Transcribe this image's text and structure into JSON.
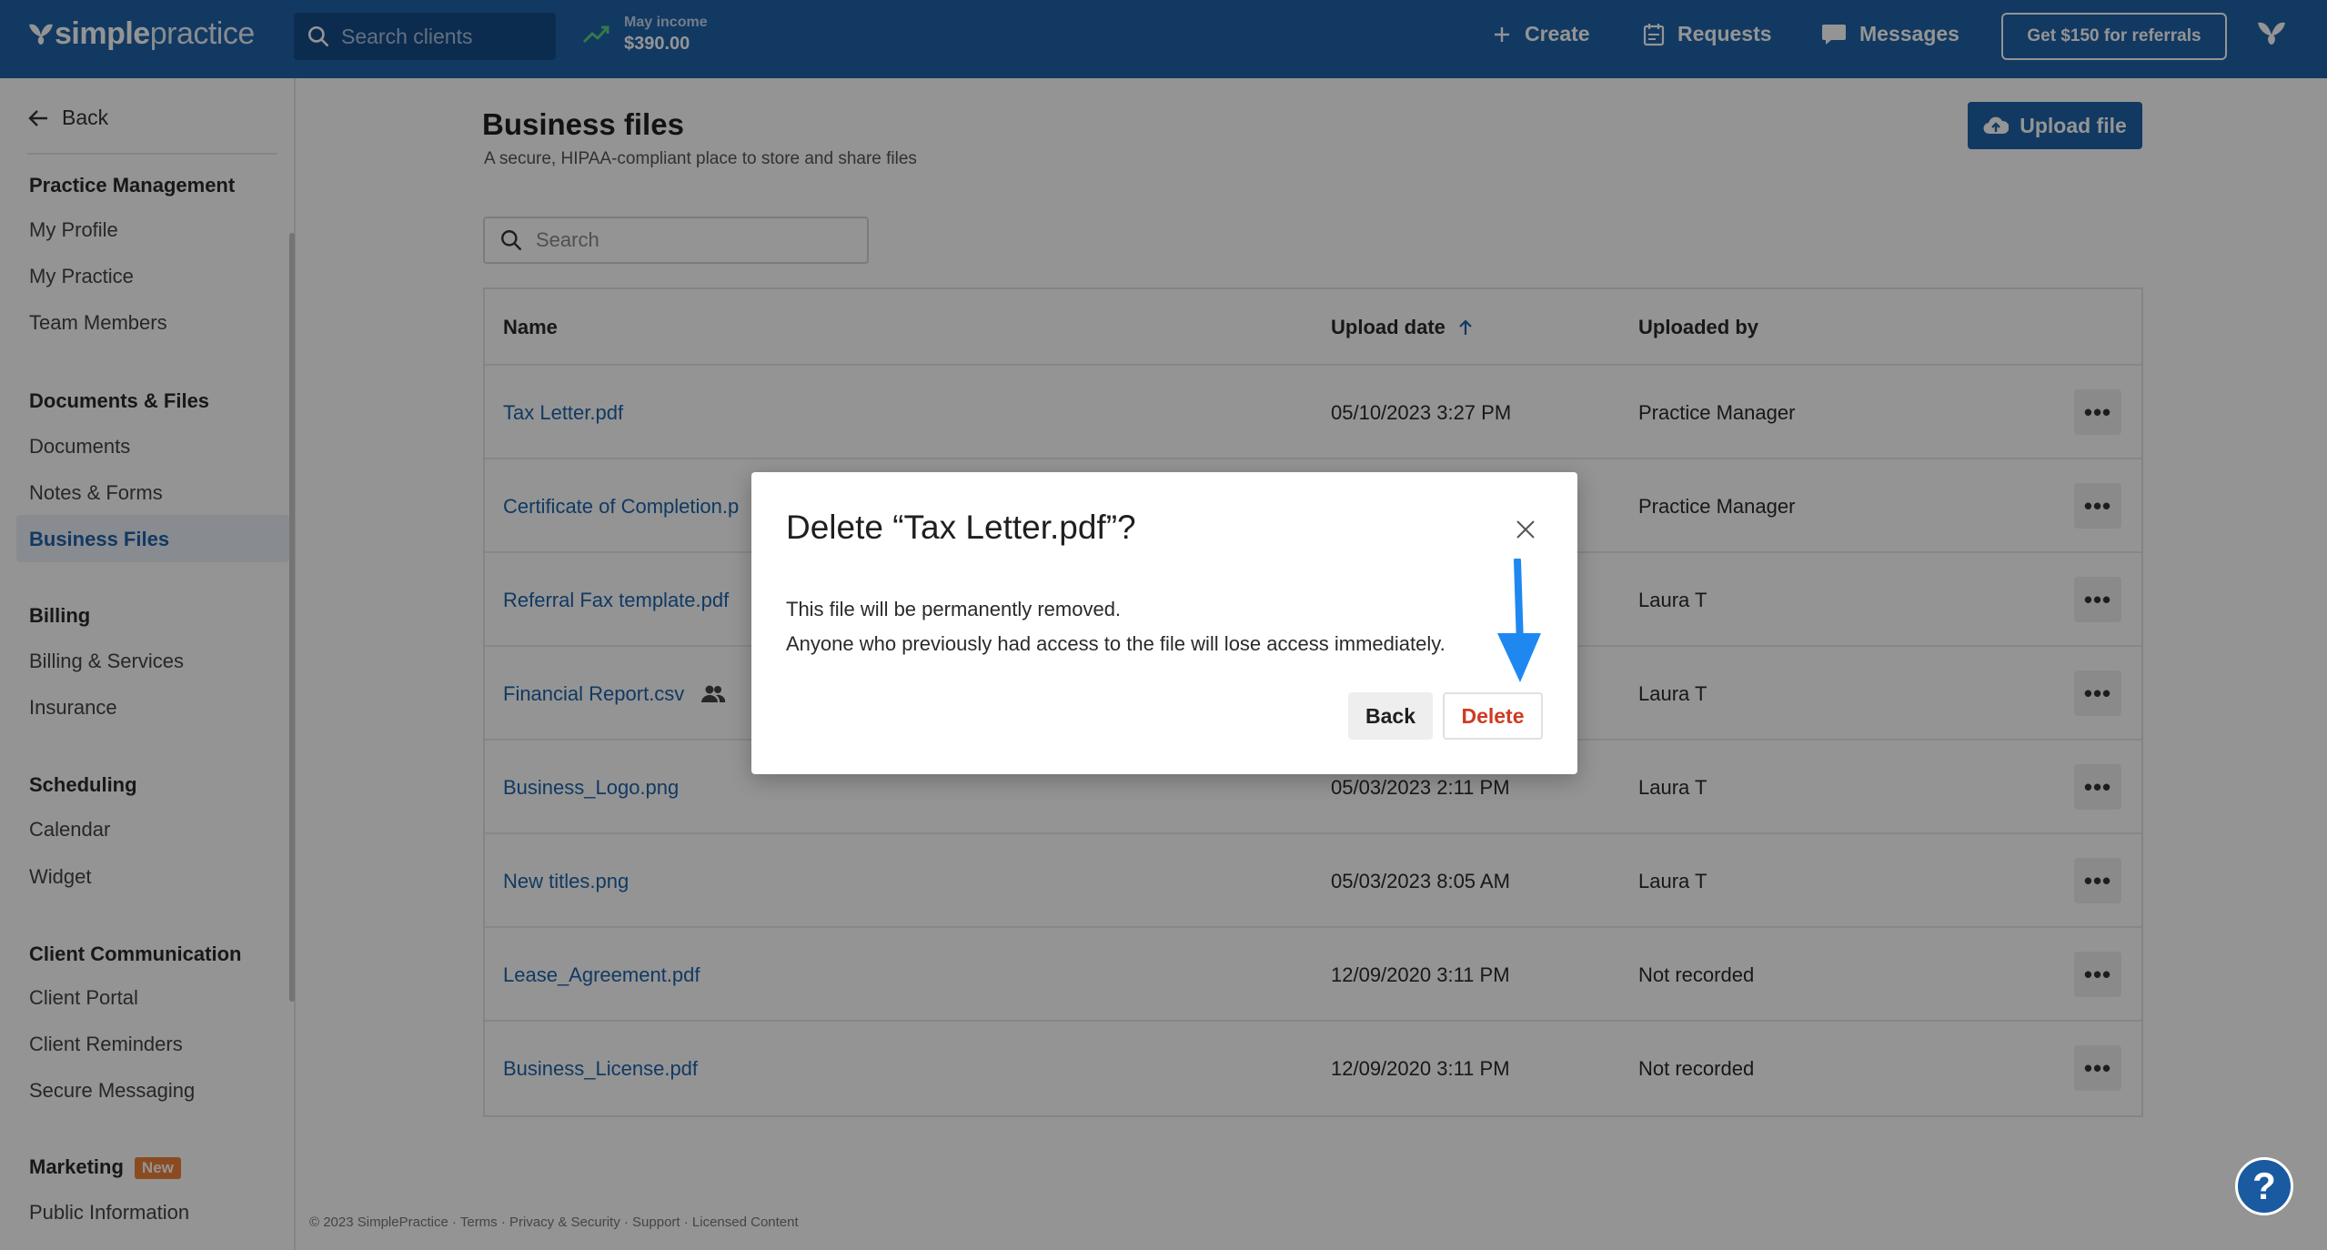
{
  "topbar": {
    "logo_text_bold": "simple",
    "logo_text_light": "practice",
    "search_placeholder": "Search clients",
    "income_label": "May income",
    "income_value": "$390.00",
    "create_label": "Create",
    "requests_label": "Requests",
    "messages_label": "Messages",
    "referral_label": "Get $150 for referrals"
  },
  "sidebar": {
    "back_label": "Back",
    "sections": [
      {
        "heading": "Practice Management",
        "items": [
          "My Profile",
          "My Practice",
          "Team Members"
        ]
      },
      {
        "heading": "Documents & Files",
        "items": [
          "Documents",
          "Notes & Forms",
          "Business Files"
        ]
      },
      {
        "heading": "Billing",
        "items": [
          "Billing & Services",
          "Insurance"
        ]
      },
      {
        "heading": "Scheduling",
        "items": [
          "Calendar",
          "Widget"
        ]
      },
      {
        "heading": "Client Communication",
        "items": [
          "Client Portal",
          "Client Reminders",
          "Secure Messaging"
        ]
      },
      {
        "heading": "Marketing",
        "badge": "New",
        "items": [
          "Public Information"
        ]
      }
    ],
    "active_item": "Business Files"
  },
  "main": {
    "title": "Business files",
    "subtitle": "A secure, HIPAA-compliant place to store and share files",
    "upload_label": "Upload file",
    "search_placeholder": "Search",
    "columns": {
      "name": "Name",
      "date": "Upload date",
      "by": "Uploaded by"
    },
    "rows": [
      {
        "name": "Tax Letter.pdf",
        "date": "05/10/2023 3:27 PM",
        "by": "Practice Manager"
      },
      {
        "name": "Certificate of Completion.p",
        "date": "",
        "by": "Practice Manager"
      },
      {
        "name": "Referral Fax template.pdf",
        "date": "",
        "by": "Laura T"
      },
      {
        "name": "Financial Report.csv",
        "date": "",
        "by": "Laura T",
        "shared": true
      },
      {
        "name": "Business_Logo.png",
        "date": "05/03/2023 2:11 PM",
        "by": "Laura T"
      },
      {
        "name": "New titles.png",
        "date": "05/03/2023 8:05 AM",
        "by": "Laura T"
      },
      {
        "name": "Lease_Agreement.pdf",
        "date": "12/09/2020 3:11 PM",
        "by": "Not recorded"
      },
      {
        "name": "Business_License.pdf",
        "date": "12/09/2020 3:11 PM",
        "by": "Not recorded"
      }
    ],
    "more_label": "•••"
  },
  "footer": {
    "text": "© 2023 SimplePractice · Terms · Privacy & Security · Support · Licensed Content"
  },
  "modal": {
    "title": "Delete “Tax Letter.pdf”?",
    "line1": "This file will be permanently removed.",
    "line2": "Anyone who previously had access to the file will lose access immediately.",
    "back_label": "Back",
    "delete_label": "Delete"
  },
  "help_label": "?",
  "colors": {
    "brand": "#1e63aa",
    "danger": "#d03a22",
    "badge": "#f0813a",
    "arrow": "#1e88f0"
  }
}
